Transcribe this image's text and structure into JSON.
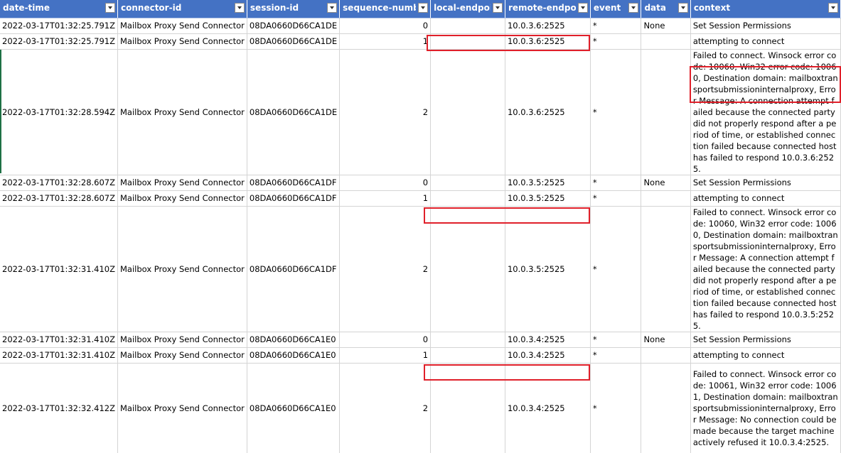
{
  "columns": [
    {
      "key": "date_time",
      "label": "date-time"
    },
    {
      "key": "connector_id",
      "label": "connector-id"
    },
    {
      "key": "session_id",
      "label": "session-id"
    },
    {
      "key": "sequence_number",
      "label": "sequence-number"
    },
    {
      "key": "local_endpoint",
      "label": "local-endpoint"
    },
    {
      "key": "remote_endpoint",
      "label": "remote-endpoint"
    },
    {
      "key": "event",
      "label": "event"
    },
    {
      "key": "data",
      "label": "data"
    },
    {
      "key": "context",
      "label": "context"
    }
  ],
  "rows": [
    {
      "date_time": "2022-03-17T01:32:25.791Z",
      "connector_id": "Mailbox Proxy Send Connector",
      "session_id": "08DA0660D66CA1DE",
      "sequence_number": "0",
      "local_endpoint": "",
      "remote_endpoint": "10.0.3.6:2525",
      "event": "*",
      "data": "None",
      "context": "Set Session Permissions"
    },
    {
      "date_time": "2022-03-17T01:32:25.791Z",
      "connector_id": "Mailbox Proxy Send Connector",
      "session_id": "08DA0660D66CA1DE",
      "sequence_number": "1",
      "local_endpoint": "",
      "remote_endpoint": "10.0.3.6:2525",
      "event": "*",
      "data": "",
      "context": "attempting to connect"
    },
    {
      "date_time": "2022-03-17T01:32:28.594Z",
      "connector_id": "Mailbox Proxy Send Connector",
      "session_id": "08DA0660D66CA1DE",
      "sequence_number": "2",
      "local_endpoint": "",
      "remote_endpoint": "10.0.3.6:2525",
      "event": "*",
      "data": "",
      "context": "Failed to connect. Winsock error code: 10060, Win32 error code: 10060, Destination domain: mailboxtransportsubmissioninternalproxy, Error Message: A connection attempt failed because the connected party did not properly respond after a period of time, or established connection failed because connected host has failed to respond 10.0.3.6:2525."
    },
    {
      "date_time": "2022-03-17T01:32:28.607Z",
      "connector_id": "Mailbox Proxy Send Connector",
      "session_id": "08DA0660D66CA1DF",
      "sequence_number": "0",
      "local_endpoint": "",
      "remote_endpoint": "10.0.3.5:2525",
      "event": "*",
      "data": "None",
      "context": "Set Session Permissions"
    },
    {
      "date_time": "2022-03-17T01:32:28.607Z",
      "connector_id": "Mailbox Proxy Send Connector",
      "session_id": "08DA0660D66CA1DF",
      "sequence_number": "1",
      "local_endpoint": "",
      "remote_endpoint": "10.0.3.5:2525",
      "event": "*",
      "data": "",
      "context": "attempting to connect"
    },
    {
      "date_time": "2022-03-17T01:32:31.410Z",
      "connector_id": "Mailbox Proxy Send Connector",
      "session_id": "08DA0660D66CA1DF",
      "sequence_number": "2",
      "local_endpoint": "",
      "remote_endpoint": "10.0.3.5:2525",
      "event": "*",
      "data": "",
      "context": "Failed to connect. Winsock error code: 10060, Win32 error code: 10060, Destination domain: mailboxtransportsubmissioninternalproxy, Error Message: A connection attempt failed because the connected party did not properly respond after a period of time, or established connection failed because connected host has failed to respond 10.0.3.5:2525."
    },
    {
      "date_time": "2022-03-17T01:32:31.410Z",
      "connector_id": "Mailbox Proxy Send Connector",
      "session_id": "08DA0660D66CA1E0",
      "sequence_number": "0",
      "local_endpoint": "",
      "remote_endpoint": "10.0.3.4:2525",
      "event": "*",
      "data": "None",
      "context": "Set Session Permissions"
    },
    {
      "date_time": "2022-03-17T01:32:31.410Z",
      "connector_id": "Mailbox Proxy Send Connector",
      "session_id": "08DA0660D66CA1E0",
      "sequence_number": "1",
      "local_endpoint": "",
      "remote_endpoint": "10.0.3.4:2525",
      "event": "*",
      "data": "",
      "context": "attempting to connect"
    },
    {
      "date_time": "2022-03-17T01:32:32.412Z",
      "connector_id": "Mailbox Proxy Send Connector",
      "session_id": "08DA0660D66CA1E0",
      "sequence_number": "2",
      "local_endpoint": "",
      "remote_endpoint": "10.0.3.4:2525",
      "event": "*",
      "data": "",
      "context": "Failed to connect. Winsock error code: 10061, Win32 error code: 10061, Destination domain: mailboxtransportsubmissioninternalproxy, Error Message: No connection could be made because the target machine actively refused it 10.0.3.4:2525."
    }
  ]
}
